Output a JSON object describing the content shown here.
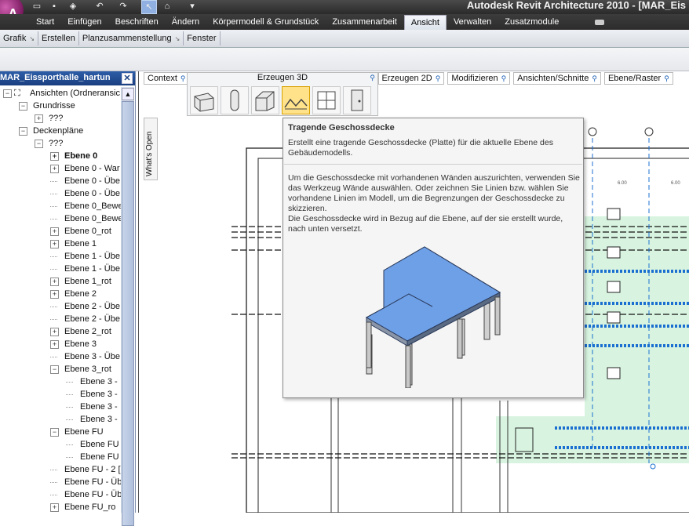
{
  "app": {
    "title": "Autodesk Revit Architecture 2010 - [MAR_Eis",
    "menu_letter": "A"
  },
  "ribbon": {
    "tabs": [
      "Start",
      "Einfügen",
      "Beschriften",
      "Ändern",
      "Körpermodell & Grundstück",
      "Zusammenarbeit",
      "Ansicht",
      "Verwalten",
      "Zusatzmodule"
    ],
    "active_tab": "Ansicht",
    "panels": [
      {
        "label": "Grafik",
        "arrow": true
      },
      {
        "label": "Erstellen",
        "arrow": false
      },
      {
        "label": "Planzusammenstellung",
        "arrow": true
      },
      {
        "label": "Fenster",
        "arrow": false
      }
    ]
  },
  "context_bar": {
    "items": [
      "Context",
      "Erzeugen 2D",
      "Modifizieren",
      "Ansichten/Schnitte",
      "Ebene/Raster"
    ],
    "create3d_label": "Erzeugen 3D",
    "whats_open": "What's Open"
  },
  "browser": {
    "title": "MAR_Eissporthalle_hartun",
    "close": "✕",
    "nodes": [
      {
        "label": "Ansichten (Ordneransic",
        "indent": 0,
        "exp": "−",
        "icon": true
      },
      {
        "label": "Grundrisse",
        "indent": 1,
        "exp": "−"
      },
      {
        "label": "???",
        "indent": 2,
        "exp": "+"
      },
      {
        "label": "Deckenpläne",
        "indent": 1,
        "exp": "−"
      },
      {
        "label": "???",
        "indent": 2,
        "exp": "−"
      },
      {
        "label": "Ebene 0",
        "indent": 3,
        "exp": "+",
        "bold": true
      },
      {
        "label": "Ebene 0 - War",
        "indent": 3,
        "exp": "+"
      },
      {
        "label": "Ebene 0 - Übe",
        "indent": 3,
        "exp": ""
      },
      {
        "label": "Ebene 0 - Übe",
        "indent": 3,
        "exp": ""
      },
      {
        "label": "Ebene 0_Bewe",
        "indent": 3,
        "exp": ""
      },
      {
        "label": "Ebene 0_Bewe",
        "indent": 3,
        "exp": ""
      },
      {
        "label": "Ebene 0_rot",
        "indent": 3,
        "exp": "+"
      },
      {
        "label": "Ebene 1",
        "indent": 3,
        "exp": "+"
      },
      {
        "label": "Ebene 1 - Übe",
        "indent": 3,
        "exp": ""
      },
      {
        "label": "Ebene 1 - Übe",
        "indent": 3,
        "exp": ""
      },
      {
        "label": "Ebene 1_rot",
        "indent": 3,
        "exp": "+"
      },
      {
        "label": "Ebene 2",
        "indent": 3,
        "exp": "+"
      },
      {
        "label": "Ebene 2 - Übe",
        "indent": 3,
        "exp": ""
      },
      {
        "label": "Ebene 2 - Übe",
        "indent": 3,
        "exp": ""
      },
      {
        "label": "Ebene 2_rot",
        "indent": 3,
        "exp": "+"
      },
      {
        "label": "Ebene 3",
        "indent": 3,
        "exp": "+"
      },
      {
        "label": "Ebene 3 - Übe",
        "indent": 3,
        "exp": ""
      },
      {
        "label": "Ebene 3_rot",
        "indent": 3,
        "exp": "−"
      },
      {
        "label": "Ebene 3 -",
        "indent": 4,
        "exp": ""
      },
      {
        "label": "Ebene 3 -",
        "indent": 4,
        "exp": ""
      },
      {
        "label": "Ebene 3 -",
        "indent": 4,
        "exp": ""
      },
      {
        "label": "Ebene 3 -",
        "indent": 4,
        "exp": ""
      },
      {
        "label": "Ebene FU",
        "indent": 3,
        "exp": "−"
      },
      {
        "label": "Ebene FU",
        "indent": 4,
        "exp": ""
      },
      {
        "label": "Ebene FU",
        "indent": 4,
        "exp": ""
      },
      {
        "label": "Ebene FU - 2 [",
        "indent": 3,
        "exp": ""
      },
      {
        "label": "Ebene FU - Üb",
        "indent": 3,
        "exp": ""
      },
      {
        "label": "Ebene FU - Üb",
        "indent": 3,
        "exp": ""
      },
      {
        "label": "Ebene FU_ro",
        "indent": 3,
        "exp": "+"
      }
    ]
  },
  "tooltip": {
    "title": "Tragende Geschossdecke",
    "description": "Erstellt eine tragende Geschossdecke (Platte) für die aktuelle Ebene des Gebäudemodells.",
    "help_1": "Um die Geschossdecke mit vorhandenen Wänden auszurichten, verwenden Sie das Werkzeug Wände auswählen. Oder zeichnen Sie Linien bzw. wählen Sie vorhandene Linien im Modell, um die Begrenzungen der Geschossdecke zu skizzieren.",
    "help_2": "Die Geschossdecke wird in Bezug auf die Ebene, auf der sie erstellt wurde, nach unten versetzt."
  },
  "drawing": {
    "dim_labels": [
      "6.00",
      "6.00"
    ],
    "colors": {
      "accent": "#1a6fd0",
      "slab_top": "#6ea0e8",
      "fill": "#d8f4e0"
    }
  }
}
